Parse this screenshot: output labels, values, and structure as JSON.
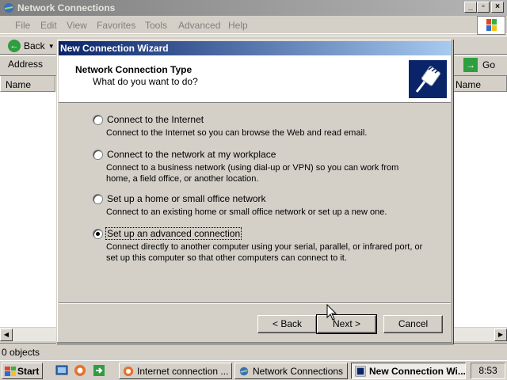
{
  "background_window": {
    "title": "Network Connections",
    "menu": [
      "File",
      "Edit",
      "View",
      "Favorites",
      "Tools",
      "Advanced",
      "Help"
    ],
    "toolbar": {
      "back_label": "Back"
    },
    "address": {
      "label": "Address",
      "go_label": "Go"
    },
    "list": {
      "column_name_left": "Name",
      "column_name_right": "Name"
    },
    "status": "0 objects"
  },
  "wizard": {
    "title": "New Connection Wizard",
    "heading": "Network Connection Type",
    "subheading": "What do you want to do?",
    "options": [
      {
        "label": "Connect to the Internet",
        "description": "Connect to the Internet so you can browse the Web and read email.",
        "checked": false
      },
      {
        "label": "Connect to the network at my workplace",
        "description": "Connect to a business network (using dial-up or VPN) so you can work from home, a field office, or another location.",
        "checked": false
      },
      {
        "label": "Set up a home or small office network",
        "description": "Connect to an existing home or small office network or set up a new one.",
        "checked": false
      },
      {
        "label": "Set up an advanced connection",
        "description": "Connect directly to another computer using your serial, parallel, or infrared port, or set up this computer so that other computers can connect to it.",
        "checked": true
      }
    ],
    "buttons": {
      "back": "< Back",
      "next": "Next >",
      "cancel": "Cancel"
    }
  },
  "taskbar": {
    "start_label": "Start",
    "tasks": [
      "Internet connection ...",
      "Network Connections",
      "New Connection Wi..."
    ],
    "clock": "8:53"
  },
  "colors": {
    "title_active": "#0a246a",
    "title_inactive": "#7f7f7f",
    "face": "#d4d0c8"
  }
}
